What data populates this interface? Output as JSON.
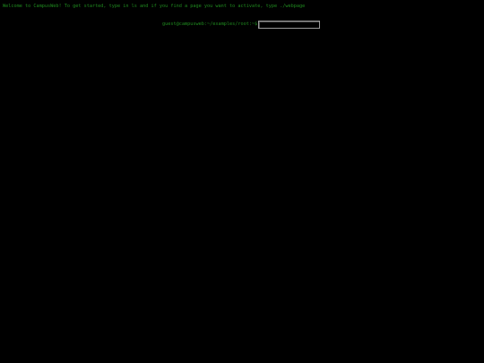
{
  "welcome_text": "Welcome to CampusWeb! To get started, type in ls and if you find a page you want to activate, type ./webpage",
  "prompt": {
    "label": "guest@campusweb:~/examples/root:~$",
    "value": ""
  },
  "colors": {
    "background": "#000000",
    "terminal_text": "#1f8a1f",
    "input_border": "#9a9a9a"
  }
}
